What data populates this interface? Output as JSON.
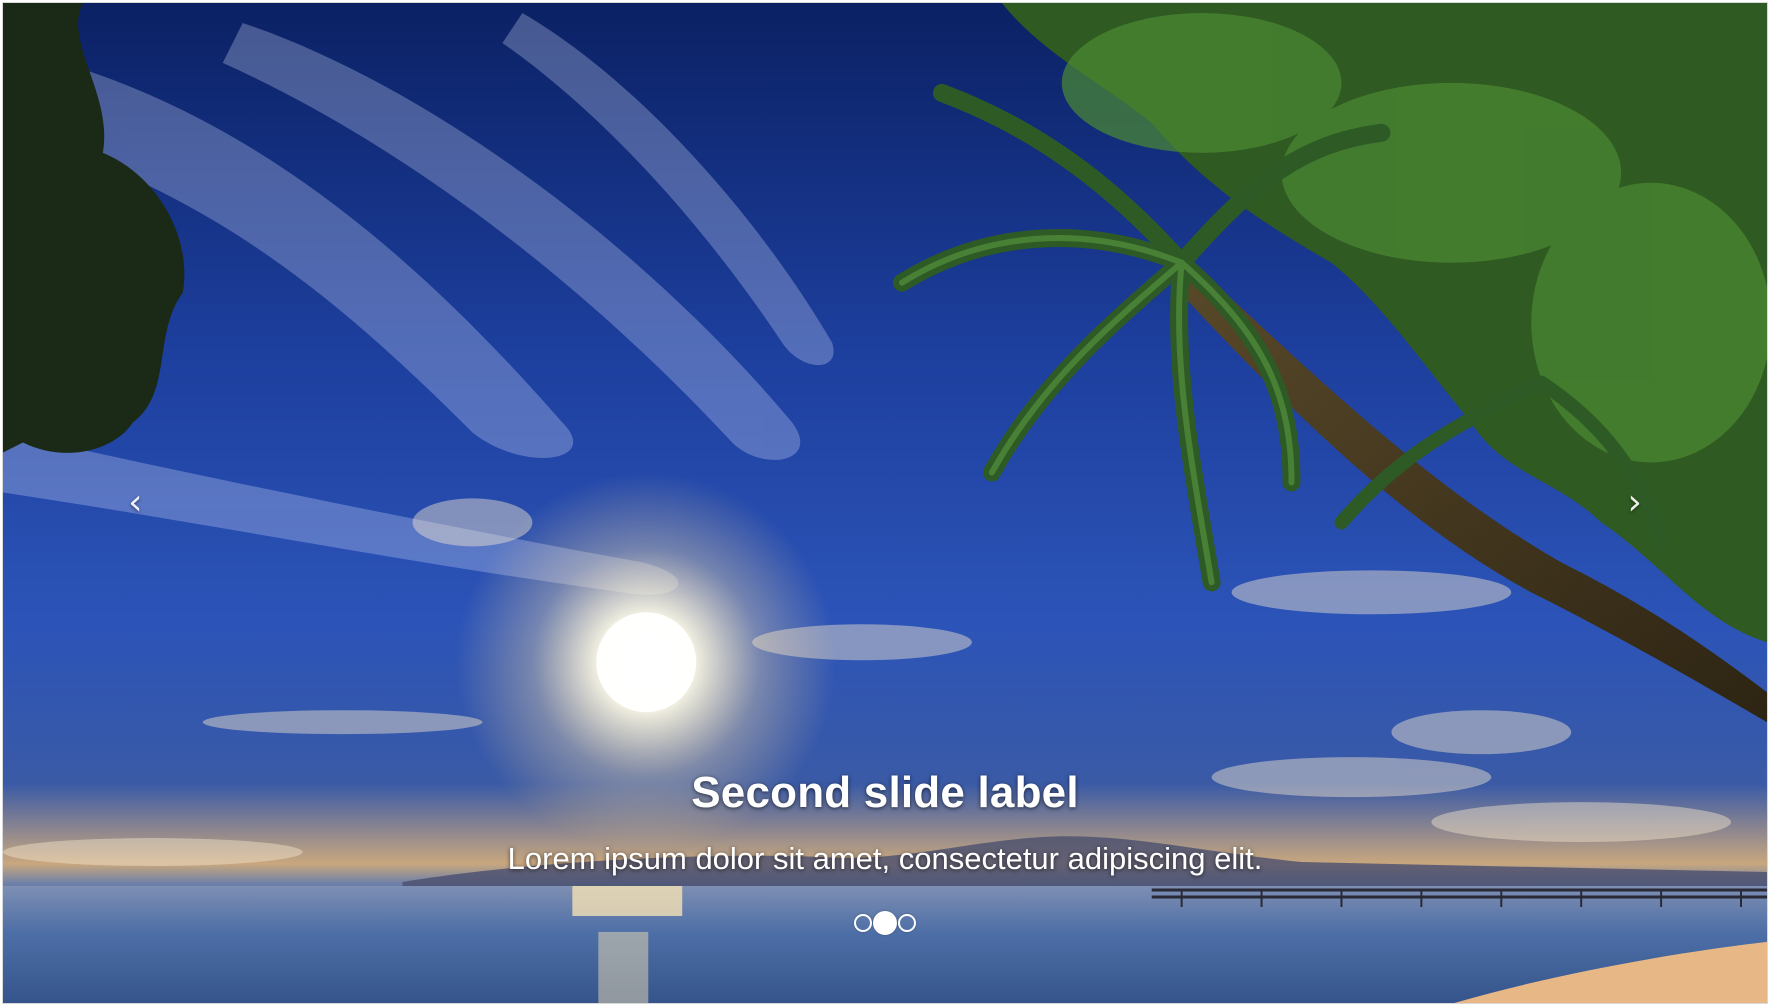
{
  "carousel": {
    "slide_image_icon": "tropical-beach-sunset-photo",
    "caption": {
      "title": "Second slide label",
      "text": "Lorem ipsum dolor sit amet, consectetur adipiscing elit."
    },
    "controls": {
      "prev_icon": "chevron-left-icon",
      "prev_glyph": "‹",
      "next_icon": "chevron-right-icon",
      "next_glyph": "›"
    },
    "indicators": {
      "count": 3,
      "active_index": 1
    }
  },
  "colors": {
    "sky_deep": "#0d2a7a",
    "sky_mid": "#2f5bc8",
    "horizon_glow": "#f2c98a",
    "sea": "#3b5f9c",
    "foliage": "#24461c",
    "sand": "#e7b886"
  }
}
